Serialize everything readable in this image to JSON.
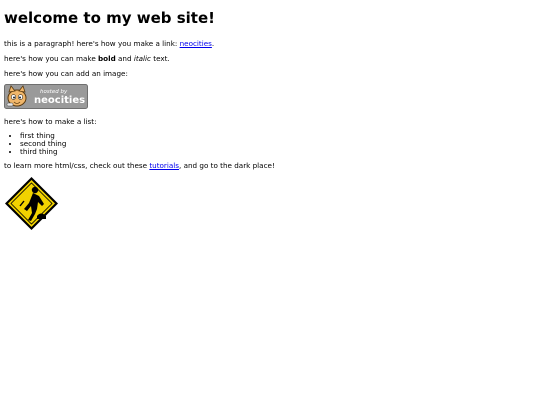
{
  "heading": "welcome to my web site!",
  "paragraph1": {
    "text": "this is a paragraph! here's how you make a link: ",
    "link_text": "neocities",
    "after": "."
  },
  "paragraph2": {
    "before": "here's how you can make ",
    "bold": "bold",
    "middle": " and ",
    "italic": "italic",
    "after": " text."
  },
  "paragraph3": {
    "text": "here's how you can add an image:"
  },
  "badge": {
    "small_text": "hosted by",
    "big_text": "neocities",
    "icon": "neocities-cat-icon"
  },
  "paragraph4": {
    "text": "here's how to make a list:"
  },
  "list": {
    "items": [
      "first thing",
      "second thing",
      "third thing"
    ]
  },
  "paragraph5": {
    "before": "to learn more html/css, check out these ",
    "link_text": "tutorials",
    "after": ", and go to the dark place!"
  },
  "construction_sign": {
    "icon": "under-construction-icon"
  },
  "colors": {
    "link": "#0000ee",
    "sign_yellow": "#f2d300",
    "badge_gray": "#9a9a9a"
  }
}
